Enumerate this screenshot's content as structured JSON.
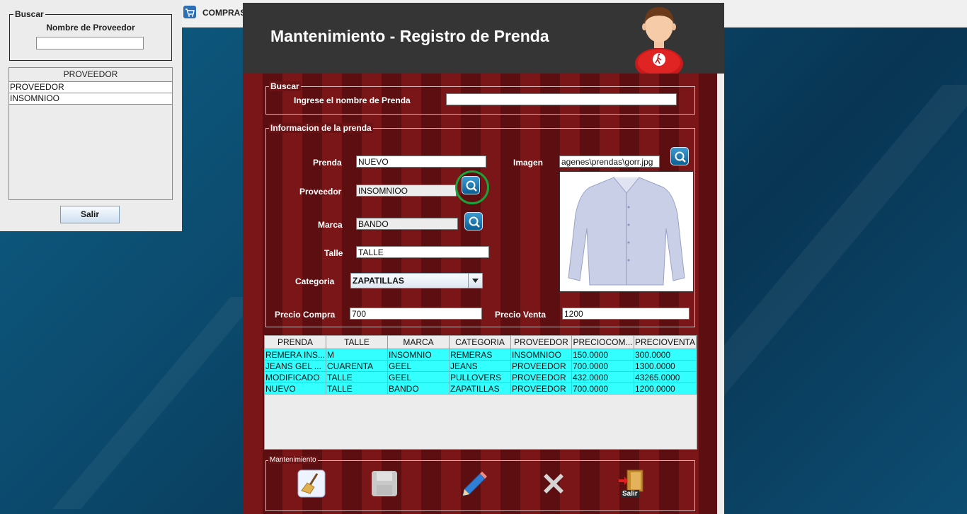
{
  "taskbar": {
    "app_title": "COMPRAS",
    "app_icon": "cart-icon"
  },
  "supplier_window": {
    "search_legend": "Buscar",
    "search_label": "Nombre de Proveedor",
    "search_value": "",
    "table_header": "PROVEEDOR",
    "rows": [
      "PROVEEDOR",
      "INSOMNIOO"
    ],
    "exit_label": "Salir"
  },
  "main_window": {
    "title": "Mantenimiento - Registro de Prenda",
    "avatar_icon": "user-avatar-icon",
    "search": {
      "legend": "Buscar",
      "label": "Ingrese el nombre de Prenda",
      "value": ""
    },
    "info": {
      "legend": "Informacion de la prenda",
      "prenda_label": "Prenda",
      "prenda_value": "NUEVO",
      "proveedor_label": "Proveedor",
      "proveedor_value": "INSOMNIOO",
      "marca_label": "Marca",
      "marca_value": "BANDO",
      "talle_label": "Talle",
      "talle_value": "TALLE",
      "categoria_label": "Categoria",
      "categoria_value": "ZAPATILLAS",
      "imagen_label": "Imagen",
      "imagen_value": "agenes\\prendas\\gorr.jpg",
      "precio_compra_label": "Precio Compra",
      "precio_compra_value": "700",
      "precio_venta_label": "Precio Venta",
      "precio_venta_value": "1200"
    },
    "table": {
      "columns": [
        "PRENDA",
        "TALLE",
        "MARCA",
        "CATEGORIA",
        "PROVEEDOR",
        "PRECIOCOM...",
        "PRECIOVENTA"
      ],
      "rows": [
        [
          "REMERA INS...",
          "M",
          "INSOMNIO",
          "REMERAS",
          "INSOMNIOO",
          "150.0000",
          "300.0000"
        ],
        [
          "JEANS GEL ...",
          "CUARENTA",
          "GEEL",
          "JEANS",
          "PROVEEDOR",
          "700.0000",
          "1300.0000"
        ],
        [
          "MODIFICADO",
          "TALLE",
          "GEEL",
          "PULLOVERS",
          "PROVEEDOR",
          "432.0000",
          "43265.0000"
        ],
        [
          "NUEVO",
          "TALLE",
          "BANDO",
          "ZAPATILLAS",
          "PROVEEDOR",
          "700.0000",
          "1200.0000"
        ]
      ]
    },
    "actions": {
      "legend": "Mantenimiento",
      "exit_caption": "Salir"
    }
  },
  "colors": {
    "highlight": "#19a33a",
    "row_bg": "#33ffff",
    "header_bg": "#353535"
  }
}
